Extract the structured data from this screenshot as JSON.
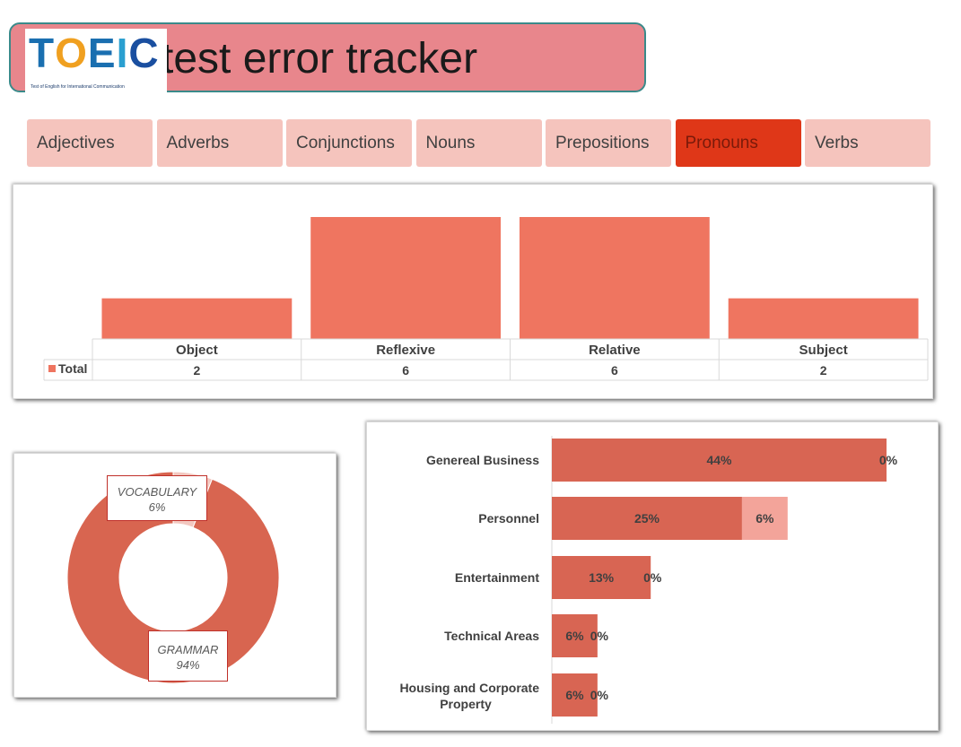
{
  "header": {
    "title": "test error tracker",
    "logo": {
      "text": "TOEIC",
      "tagline": "Test of English for International Communication"
    }
  },
  "slicer": {
    "items": [
      {
        "label": "Adjectives",
        "selected": false
      },
      {
        "label": "Adverbs",
        "selected": false
      },
      {
        "label": "Conjunctions",
        "selected": false
      },
      {
        "label": "Nouns",
        "selected": false
      },
      {
        "label": "Prepositions",
        "selected": false
      },
      {
        "label": "Pronouns",
        "selected": true
      },
      {
        "label": "Verbs",
        "selected": false
      }
    ]
  },
  "colors": {
    "bar": "#ef7560",
    "donut": "#d86550",
    "hbar_primary": "#d86553",
    "hbar_secondary": "#f3a49a",
    "slicer_selected": "#df3718",
    "slicer_normal": "#f5c4bd",
    "banner": "#e8868c"
  },
  "chart_data": [
    {
      "type": "bar",
      "categories": [
        "Object",
        "Reflexive",
        "Relative",
        "Subject"
      ],
      "series": [
        {
          "name": "Total",
          "values": [
            2,
            6,
            6,
            2
          ]
        }
      ],
      "data_table": true,
      "ylim": [
        0,
        6
      ]
    },
    {
      "type": "pie",
      "donut": true,
      "labels": [
        "VOCABULARY",
        "GRAMMAR"
      ],
      "values": [
        6,
        94
      ],
      "value_labels": [
        "6%",
        "94%"
      ]
    },
    {
      "type": "bar",
      "orientation": "horizontal",
      "stacked": true,
      "categories": [
        "Genereal Business",
        "Personnel",
        "Entertainment",
        "Technical Areas",
        "Housing and Corporate Property"
      ],
      "series": [
        {
          "values": [
            44,
            25,
            13,
            6,
            6
          ],
          "labels": [
            "44%",
            "25%",
            "13%",
            "6%",
            "6%"
          ]
        },
        {
          "values": [
            0,
            6,
            0,
            0,
            0
          ],
          "labels": [
            "0%",
            "6%",
            "0%",
            "0%",
            "0%"
          ]
        }
      ],
      "xlim": [
        0,
        50
      ]
    }
  ]
}
